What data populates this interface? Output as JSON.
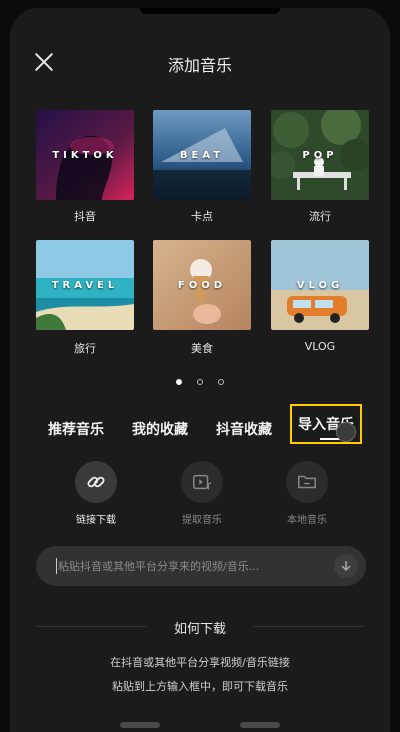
{
  "header": {
    "title": "添加音乐"
  },
  "categories": [
    {
      "label": "TIKTOK",
      "caption": "抖音"
    },
    {
      "label": "BEAT",
      "caption": "卡点"
    },
    {
      "label": "POP",
      "caption": "流行"
    },
    {
      "label": "TRAVEL",
      "caption": "旅行"
    },
    {
      "label": "FOOD",
      "caption": "美食"
    },
    {
      "label": "VLOG",
      "caption": "VLOG"
    }
  ],
  "tabs": [
    {
      "label": "推荐音乐"
    },
    {
      "label": "我的收藏"
    },
    {
      "label": "抖音收藏"
    },
    {
      "label": "导入音乐"
    }
  ],
  "actions": [
    {
      "label": "链接下载",
      "icon": "link-icon"
    },
    {
      "label": "提取音乐",
      "icon": "video-music-icon"
    },
    {
      "label": "本地音乐",
      "icon": "folder-icon"
    }
  ],
  "input": {
    "placeholder": "粘贴抖音或其他平台分享来的视频/音乐..."
  },
  "help": {
    "title": "如何下载",
    "line1": "在抖音或其他平台分享视频/音乐链接",
    "line2": "粘贴到上方输入框中，即可下载音乐"
  },
  "colors": {
    "accent": "#ffcc00",
    "background": "#1b1b1b"
  }
}
